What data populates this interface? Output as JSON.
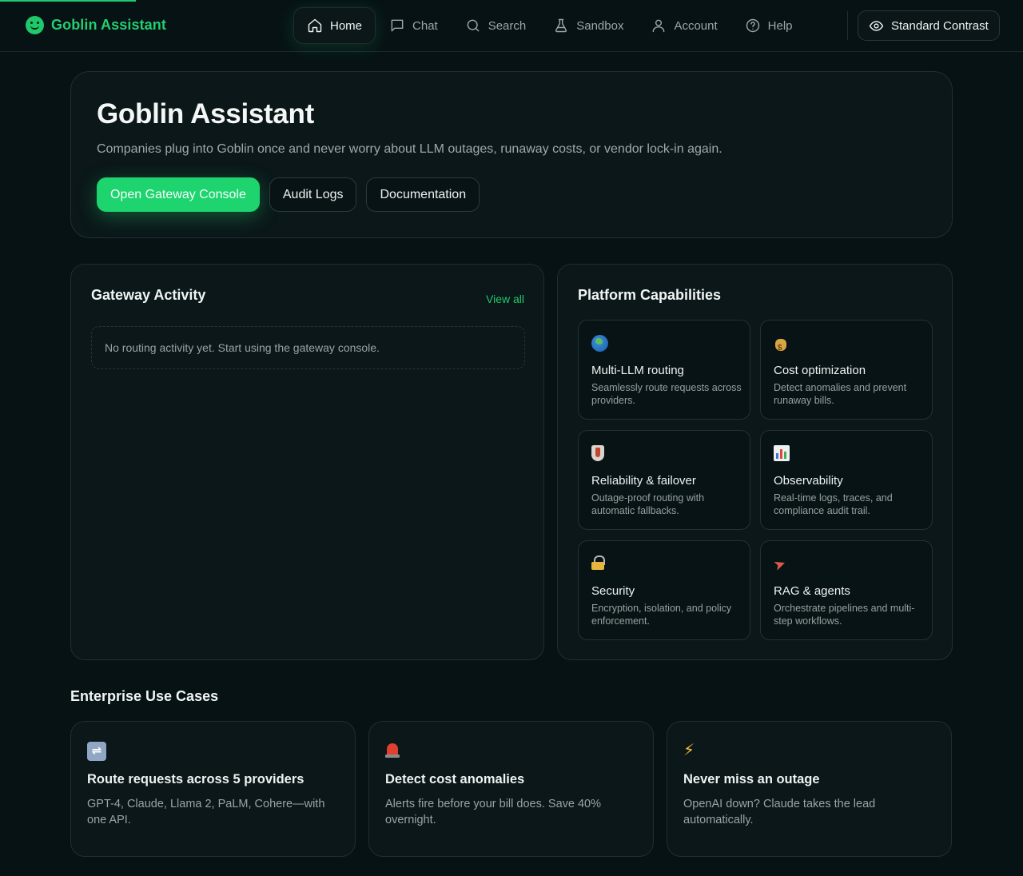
{
  "brand": {
    "name": "Goblin Assistant"
  },
  "nav": {
    "items": [
      {
        "label": "Home",
        "icon": "home-icon",
        "active": true
      },
      {
        "label": "Chat",
        "icon": "chat-icon"
      },
      {
        "label": "Search",
        "icon": "search-icon"
      },
      {
        "label": "Sandbox",
        "icon": "flask-icon"
      },
      {
        "label": "Account",
        "icon": "user-icon"
      },
      {
        "label": "Help",
        "icon": "help-icon"
      }
    ],
    "contrast_label": "Standard Contrast"
  },
  "hero": {
    "title": "Goblin Assistant",
    "subtitle": "Companies plug into Goblin once and never worry about LLM outages, runaway costs, or vendor lock-in again.",
    "primary_label": "Open Gateway Console",
    "audit_label": "Audit Logs",
    "docs_label": "Documentation"
  },
  "activity": {
    "title": "Gateway Activity",
    "view_all": "View all",
    "empty_message": "No routing activity yet. Start using the gateway console."
  },
  "capabilities": {
    "title": "Platform Capabilities",
    "items": [
      {
        "icon": "globe-icon",
        "title": "Multi-LLM routing",
        "desc": "Seamlessly route requests across providers."
      },
      {
        "icon": "money-bag-icon",
        "title": "Cost optimization",
        "desc": "Detect anomalies and prevent runaway bills."
      },
      {
        "icon": "shield-icon",
        "title": "Reliability & failover",
        "desc": "Outage-proof routing with automatic fallbacks."
      },
      {
        "icon": "bar-chart-icon",
        "title": "Observability",
        "desc": "Real-time logs, traces, and compliance audit trail."
      },
      {
        "icon": "lock-icon",
        "title": "Security",
        "desc": "Encryption, isolation, and policy enforcement."
      },
      {
        "icon": "rocket-icon",
        "title": "RAG & agents",
        "desc": "Orchestrate pipelines and multi-step workflows."
      }
    ]
  },
  "use_cases": {
    "title": "Enterprise Use Cases",
    "items": [
      {
        "icon": "shuffle-icon",
        "title": "Route requests across 5 providers",
        "desc": "GPT-4, Claude, Llama 2, PaLM, Cohere—with one API."
      },
      {
        "icon": "siren-icon",
        "title": "Detect cost anomalies",
        "desc": "Alerts fire before your bill does. Save 40% overnight."
      },
      {
        "icon": "lightning-icon",
        "title": "Never miss an outage",
        "desc": "OpenAI down? Claude takes the lead automatically."
      }
    ]
  },
  "colors": {
    "accent": "#1fc96b",
    "background": "#071215",
    "card": "#0b1719"
  }
}
